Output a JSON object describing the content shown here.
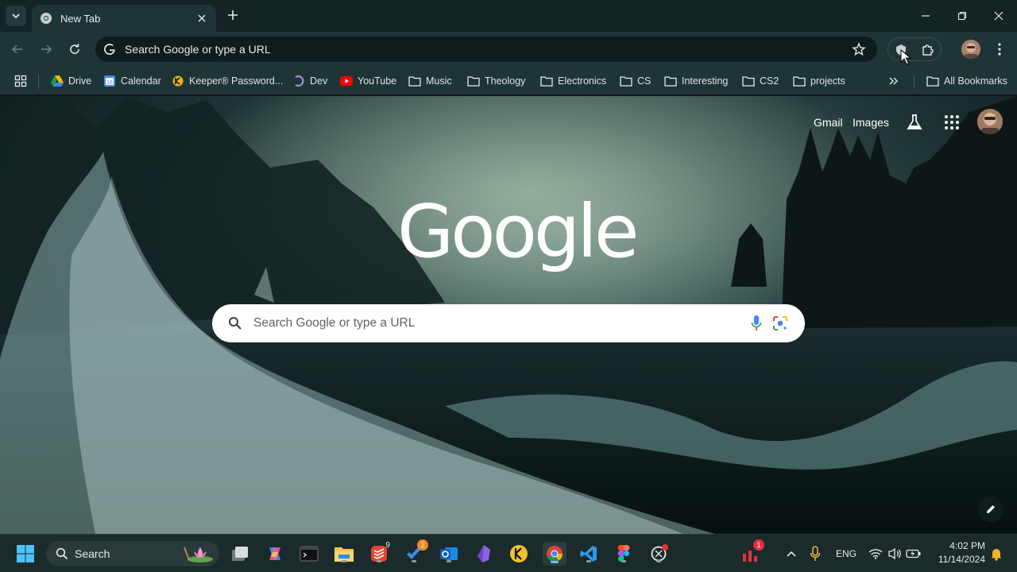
{
  "tab": {
    "title": "New Tab",
    "close_icon": "close-icon"
  },
  "window_controls": {
    "minimize": "minimize-icon",
    "restore": "restore-icon",
    "close": "close-icon"
  },
  "omnibox": {
    "text": "Search Google or type a URL"
  },
  "bookmarks": [
    {
      "label": "Drive",
      "icon": "google-drive-icon"
    },
    {
      "label": "Calendar",
      "icon": "google-calendar-icon"
    },
    {
      "label": "Keeper® Password...",
      "icon": "keeper-icon"
    },
    {
      "label": "Dev",
      "icon": "dev-icon"
    },
    {
      "label": "YouTube",
      "icon": "youtube-icon"
    },
    {
      "label": "Music",
      "icon": "folder-icon"
    },
    {
      "label": "Theology",
      "icon": "folder-icon"
    },
    {
      "label": "Electronics",
      "icon": "folder-icon"
    },
    {
      "label": "CS",
      "icon": "folder-icon"
    },
    {
      "label": "Interesting",
      "icon": "folder-icon"
    },
    {
      "label": "CS2",
      "icon": "folder-icon"
    },
    {
      "label": "projects",
      "icon": "folder-icon"
    }
  ],
  "all_bookmarks": "All Bookmarks",
  "ntp": {
    "gmail": "Gmail",
    "images": "Images",
    "logo": "Google",
    "search_placeholder": "Search Google or type a URL"
  },
  "taskbar": {
    "search_label": "Search",
    "badges": {
      "todoist": "9",
      "todo": "2",
      "mail": "1"
    },
    "language": "ENG",
    "time": "4:02 PM",
    "date": "11/14/2024"
  },
  "colors": {
    "tabstrip": "#142324",
    "toolbar": "#1f3436",
    "omnibox": "#0f1c1d",
    "taskbar": "#1b2a2b",
    "badge_red": "#e3323f",
    "badge_orange": "#f08a24"
  }
}
